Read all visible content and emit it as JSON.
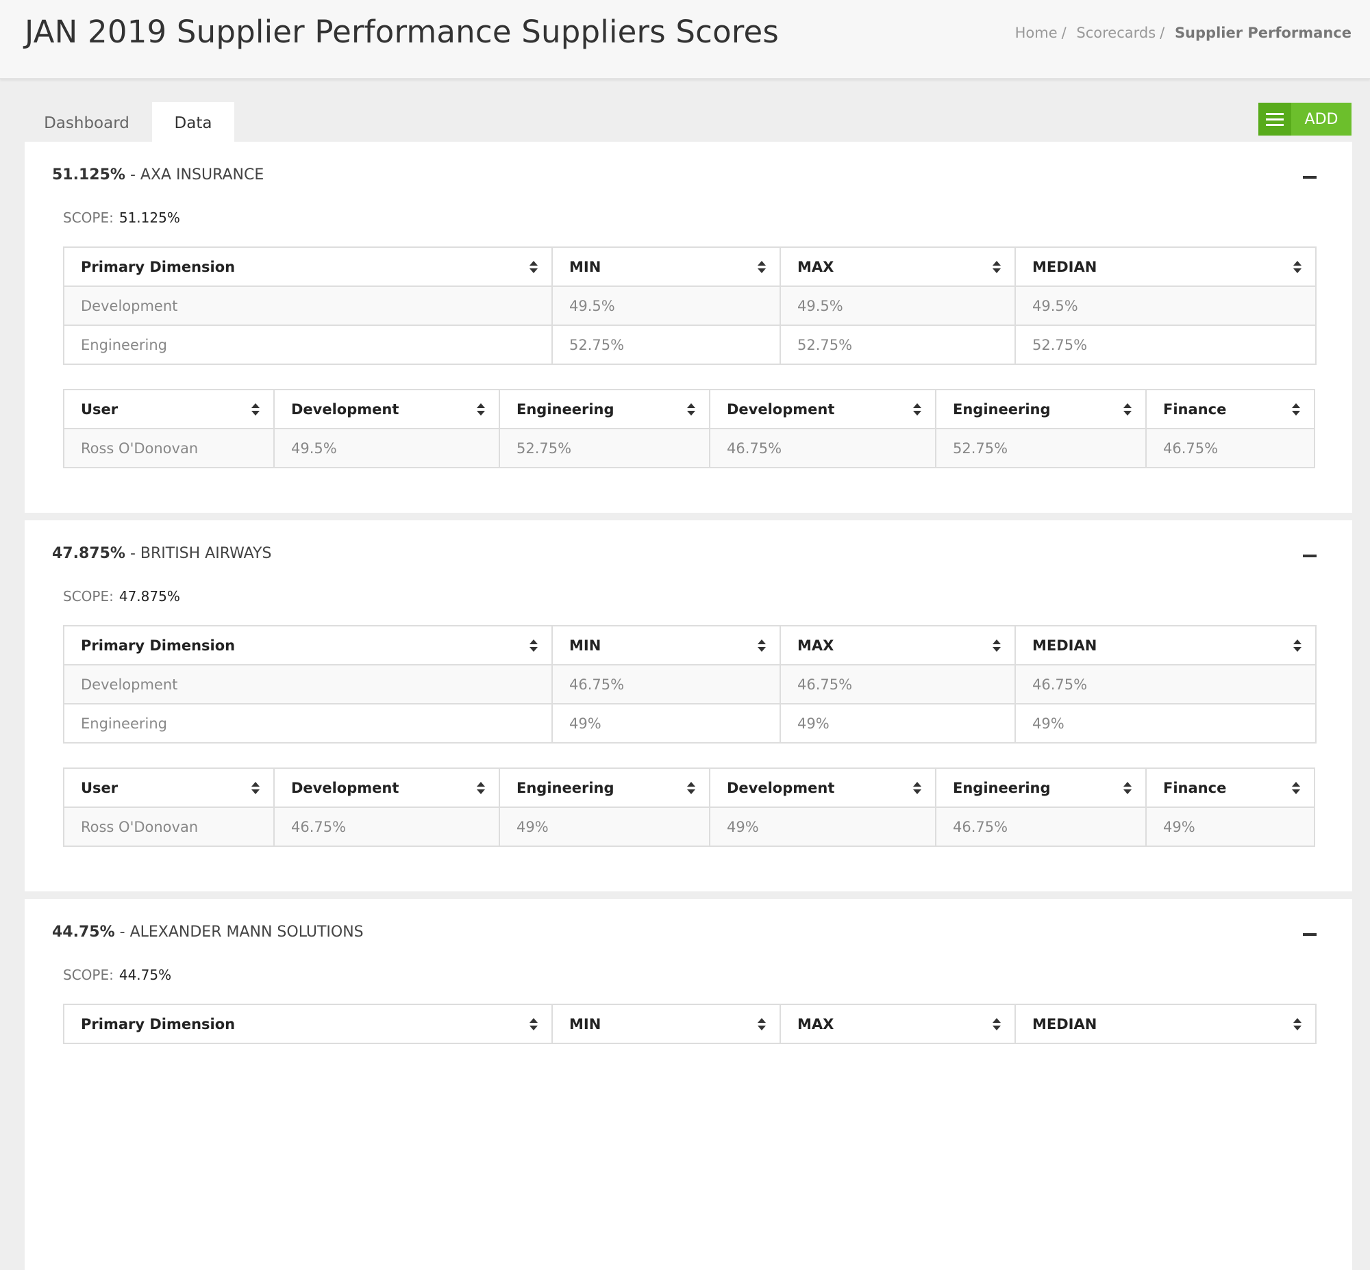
{
  "header": {
    "title": "JAN 2019 Supplier Performance Suppliers Scores",
    "breadcrumb": [
      "Home",
      "Scorecards",
      "Supplier Performance"
    ]
  },
  "tabs": [
    {
      "label": "Dashboard",
      "active": false
    },
    {
      "label": "Data",
      "active": true
    }
  ],
  "add_button": {
    "label": "ADD",
    "icon": "menu-icon",
    "color": "#6cbf2c"
  },
  "dimension_headers": [
    "Primary Dimension",
    "MIN",
    "MAX",
    "MEDIAN"
  ],
  "user_headers": [
    "User",
    "Development",
    "Engineering",
    "Development",
    "Engineering",
    "Finance"
  ],
  "scope_label": "SCOPE:",
  "suppliers": [
    {
      "score": "51.125%",
      "separator": " - ",
      "name": "AXA INSURANCE",
      "scope": "51.125%",
      "dimension_rows": [
        [
          "Development",
          "49.5%",
          "49.5%",
          "49.5%"
        ],
        [
          "Engineering",
          "52.75%",
          "52.75%",
          "52.75%"
        ]
      ],
      "user_rows": [
        [
          "Ross O'Donovan",
          "49.5%",
          "52.75%",
          "46.75%",
          "52.75%",
          "46.75%"
        ]
      ]
    },
    {
      "score": "47.875%",
      "separator": " - ",
      "name": "BRITISH AIRWAYS",
      "scope": "47.875%",
      "dimension_rows": [
        [
          "Development",
          "46.75%",
          "46.75%",
          "46.75%"
        ],
        [
          "Engineering",
          "49%",
          "49%",
          "49%"
        ]
      ],
      "user_rows": [
        [
          "Ross O'Donovan",
          "46.75%",
          "49%",
          "49%",
          "46.75%",
          "49%"
        ]
      ]
    },
    {
      "score": "44.75%",
      "separator": " - ",
      "name": "ALEXANDER MANN SOLUTIONS",
      "scope": "44.75%",
      "dimension_rows": [],
      "user_rows": []
    }
  ]
}
